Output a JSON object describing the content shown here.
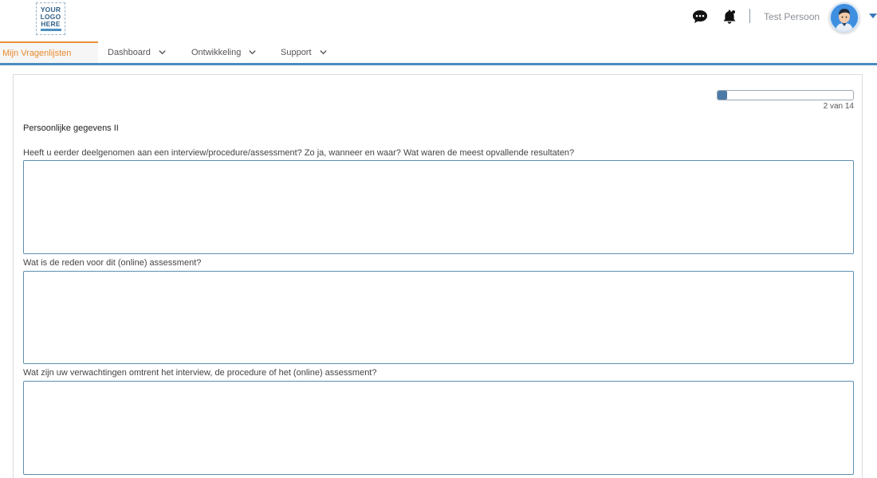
{
  "header": {
    "logo_text": "YOUR\nLOGO\nHERE",
    "user_name": "Test Persoon",
    "icons": [
      "chat-icon",
      "bell-icon",
      "avatar",
      "chevron-down-icon"
    ]
  },
  "nav": {
    "tabs": [
      {
        "label": "Mijn Vragenlijsten",
        "active": true
      },
      {
        "label": "Dashboard",
        "has_dropdown": true
      },
      {
        "label": "Ontwikkeling",
        "has_dropdown": true
      },
      {
        "label": "Support",
        "has_dropdown": true
      }
    ]
  },
  "progress": {
    "label": "2 van 14",
    "fraction": 0.0714
  },
  "form": {
    "section_title": "Persoonlijke gegevens II",
    "questions": [
      {
        "label": "Heeft u eerder deelgenomen aan een interview/procedure/assessment? Zo ja, wanneer en waar? Wat waren de meest opvallende resultaten?",
        "value": ""
      },
      {
        "label": "Wat is de reden voor dit (online) assessment?",
        "value": ""
      },
      {
        "label": "Wat zijn uw verwachtingen omtrent het interview, de procedure of het (online) assessment?",
        "value": ""
      }
    ]
  },
  "colors": {
    "accent_orange": "#e8892e",
    "nav_border_blue": "#4a8cbf",
    "progress_fill": "#4b7aa6",
    "input_border": "#5d8fb0"
  }
}
